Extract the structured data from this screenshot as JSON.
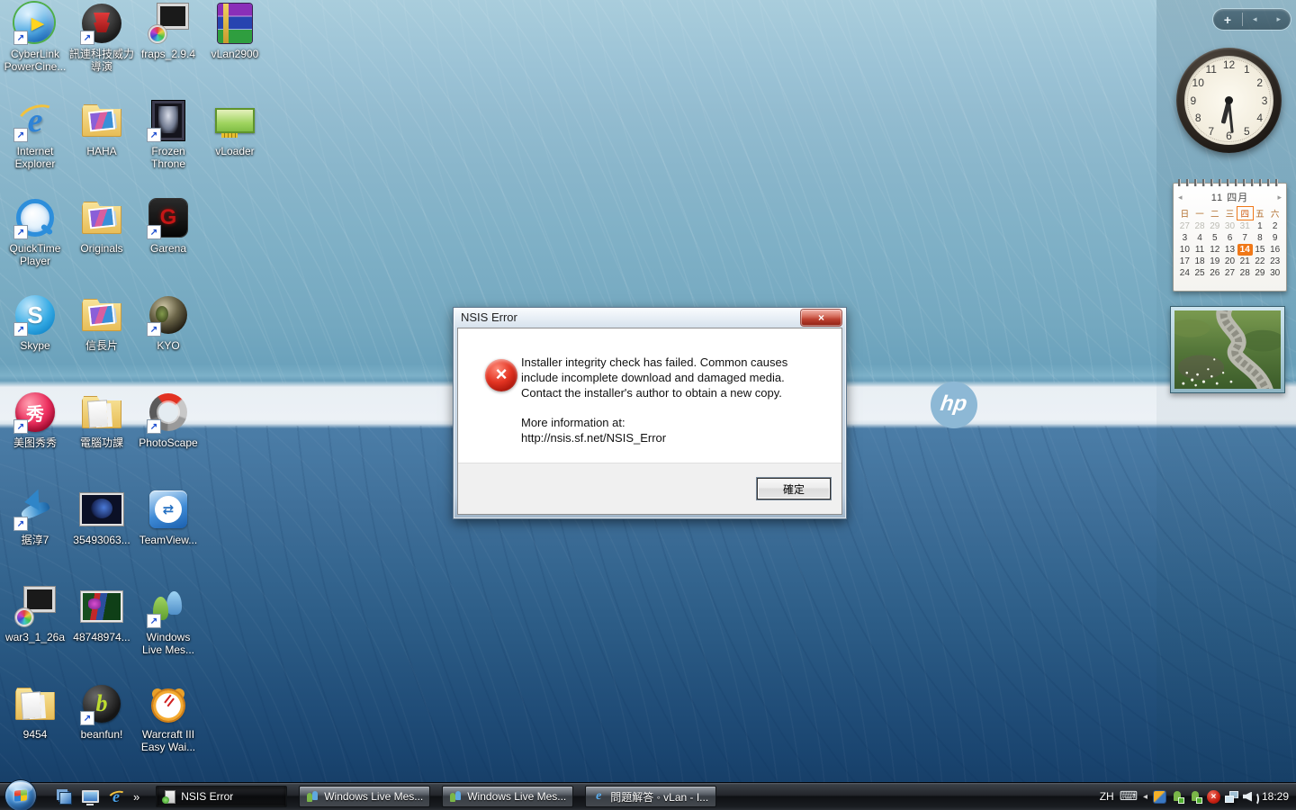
{
  "wallpaper": {
    "logo_text": "hp"
  },
  "desktop": {
    "icons": [
      {
        "label": "CyberLink PowerCine...",
        "icon": "play",
        "arrow": 1
      },
      {
        "label": "訊連科技威力導演",
        "icon": "chair",
        "arrow": 1
      },
      {
        "label": "fraps_2.9.4",
        "icon": "pc",
        "arrow": 0
      },
      {
        "label": "vLan2900",
        "icon": "rar",
        "arrow": 0
      },
      {
        "label": "Internet Explorer",
        "icon": "ie",
        "arrow": 1
      },
      {
        "label": "HAHA",
        "icon": "folder-photo",
        "arrow": 0
      },
      {
        "label": "Frozen Throne",
        "icon": "portrait",
        "arrow": 1
      },
      {
        "label": "vLoader",
        "icon": "card",
        "arrow": 0
      },
      {
        "label": "QuickTime Player",
        "icon": "qt",
        "arrow": 1
      },
      {
        "label": "Originals",
        "icon": "folder-photo",
        "arrow": 0
      },
      {
        "label": "Garena",
        "icon": "garena",
        "arrow": 1
      },
      {
        "empty": 1
      },
      {
        "label": "Skype",
        "icon": "skype",
        "arrow": 1
      },
      {
        "label": "信長片",
        "icon": "folder-photo",
        "arrow": 0
      },
      {
        "label": "KYO",
        "icon": "sphere",
        "arrow": 1
      },
      {
        "empty": 1
      },
      {
        "label": "美图秀秀",
        "icon": "meitu",
        "arrow": 1
      },
      {
        "label": "電腦功課",
        "icon": "folder",
        "arrow": 0
      },
      {
        "label": "PhotoScape",
        "icon": "photoscape",
        "arrow": 1
      },
      {
        "empty": 1
      },
      {
        "label": "据淳7",
        "icon": "bird",
        "arrow": 1
      },
      {
        "label": "35493063...",
        "icon": "imgdark",
        "arrow": 0
      },
      {
        "label": "TeamView...",
        "icon": "teamviewer",
        "arrow": 0
      },
      {
        "empty": 1
      },
      {
        "label": "war3_1_26a",
        "icon": "pc",
        "arrow": 0
      },
      {
        "label": "48748974...",
        "icon": "imgcolor",
        "arrow": 0
      },
      {
        "label": "Windows Live Mes...",
        "icon": "msn",
        "arrow": 1
      },
      {
        "empty": 1
      },
      {
        "label": "9454",
        "icon": "folder",
        "arrow": 0
      },
      {
        "label": "beanfun!",
        "icon": "beanfun",
        "arrow": 1
      },
      {
        "label": "Warcraft III Easy Wai...",
        "icon": "alarm",
        "arrow": 0
      },
      {
        "empty": 1
      }
    ]
  },
  "gadgets": {
    "controls": {
      "add": "+",
      "prev": "◂",
      "next": "▸"
    },
    "clock": {
      "time": "6:29",
      "numbers": [
        "1",
        "2",
        "3",
        "4",
        "5",
        "6",
        "7",
        "8",
        "9",
        "10",
        "11",
        "12"
      ]
    },
    "calendar": {
      "prev": "◂",
      "next": "▸",
      "title": "11 四月",
      "day_headers": [
        {
          "d": "日"
        },
        {
          "d": "一"
        },
        {
          "d": "二"
        },
        {
          "d": "三"
        },
        {
          "d": "四",
          "today": 1
        },
        {
          "d": "五"
        },
        {
          "d": "六"
        }
      ],
      "cells": [
        {
          "d": "27",
          "muted": 1
        },
        {
          "d": "28",
          "muted": 1
        },
        {
          "d": "29",
          "muted": 1
        },
        {
          "d": "30",
          "muted": 1
        },
        {
          "d": "31",
          "muted": 1
        },
        {
          "d": "1"
        },
        {
          "d": "2"
        },
        {
          "d": "3"
        },
        {
          "d": "4"
        },
        {
          "d": "5"
        },
        {
          "d": "6"
        },
        {
          "d": "7"
        },
        {
          "d": "8"
        },
        {
          "d": "9"
        },
        {
          "d": "10"
        },
        {
          "d": "11"
        },
        {
          "d": "12"
        },
        {
          "d": "13"
        },
        {
          "d": "14",
          "selected": 1
        },
        {
          "d": "15"
        },
        {
          "d": "16"
        },
        {
          "d": "17"
        },
        {
          "d": "18"
        },
        {
          "d": "19"
        },
        {
          "d": "20"
        },
        {
          "d": "21"
        },
        {
          "d": "22"
        },
        {
          "d": "23"
        },
        {
          "d": "24"
        },
        {
          "d": "25"
        },
        {
          "d": "26"
        },
        {
          "d": "27"
        },
        {
          "d": "28"
        },
        {
          "d": "29"
        },
        {
          "d": "30"
        }
      ]
    },
    "photo": {
      "subject": "stream through flowering meadow"
    }
  },
  "dialog": {
    "title": "NSIS Error",
    "close": "×",
    "message": "Installer integrity check has failed. Common causes include incomplete download and damaged media. Contact the installer's author to obtain a new copy.",
    "more_info_label": "More information at:",
    "more_info_url": "http://nsis.sf.net/NSIS_Error",
    "ok_label": "確定"
  },
  "taskbar": {
    "quick_launch": [
      {
        "name": "flip3d"
      },
      {
        "name": "show-desktop"
      },
      {
        "name": "ie"
      }
    ],
    "overflow_chevron": "»",
    "tasks": [
      {
        "label": "NSIS Error",
        "icon": "nsis",
        "active": 1
      },
      {
        "label": "Windows Live Mes...",
        "icon": "msn"
      },
      {
        "label": "Windows Live Mes...",
        "icon": "msn"
      },
      {
        "label": "問題解答 ◦ vLan - I...",
        "icon": "ie"
      }
    ],
    "tray": {
      "lang": "ZH",
      "collapse": "◂",
      "icons": [
        {
          "name": "update"
        },
        {
          "name": "msn"
        },
        {
          "name": "msn"
        },
        {
          "name": "alert"
        },
        {
          "name": "network"
        },
        {
          "name": "volume"
        }
      ],
      "time": "18:29"
    }
  }
}
